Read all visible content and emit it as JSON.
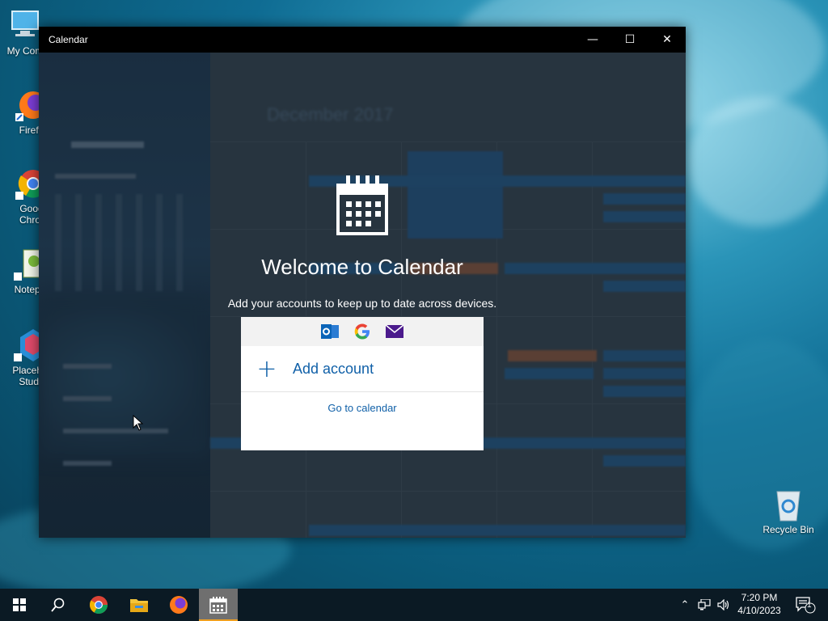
{
  "desktop": {
    "icons": [
      {
        "label": "My Com",
        "icon": "computer-icon"
      },
      {
        "label": "Firefo",
        "icon": "firefox-icon"
      },
      {
        "label": "Goog Chror",
        "icon": "chrome-icon"
      },
      {
        "label": "Notepa",
        "icon": "notepad-icon"
      },
      {
        "label": "Placeho Studi",
        "icon": "placeholder-studio-icon"
      },
      {
        "label": "Recycle Bin",
        "icon": "recycle-bin-icon"
      }
    ]
  },
  "window": {
    "title": "Calendar",
    "controls": {
      "minimize": "—",
      "maximize": "☐",
      "close": "✕"
    }
  },
  "background_calendar": {
    "month_heading": "December 2017"
  },
  "welcome": {
    "title": "Welcome to Calendar",
    "subtitle": "Add your accounts to keep up to date across devices.",
    "providers": [
      "outlook-icon",
      "google-icon",
      "mail-icon"
    ],
    "add_account_label": "Add account",
    "go_to_calendar_label": "Go to calendar"
  },
  "taskbar": {
    "items": [
      "start-icon",
      "search-icon",
      "chrome-icon",
      "file-explorer-icon",
      "firefox-icon",
      "calendar-icon"
    ],
    "active_item": "calendar-icon",
    "notification_count": "1",
    "time": "7:20 PM",
    "date": "4/10/2023"
  },
  "colors": {
    "accent": "#1060a8",
    "titlebar": "#000000",
    "taskbar": "#0b1a24",
    "active_indicator": "#f0a020"
  }
}
